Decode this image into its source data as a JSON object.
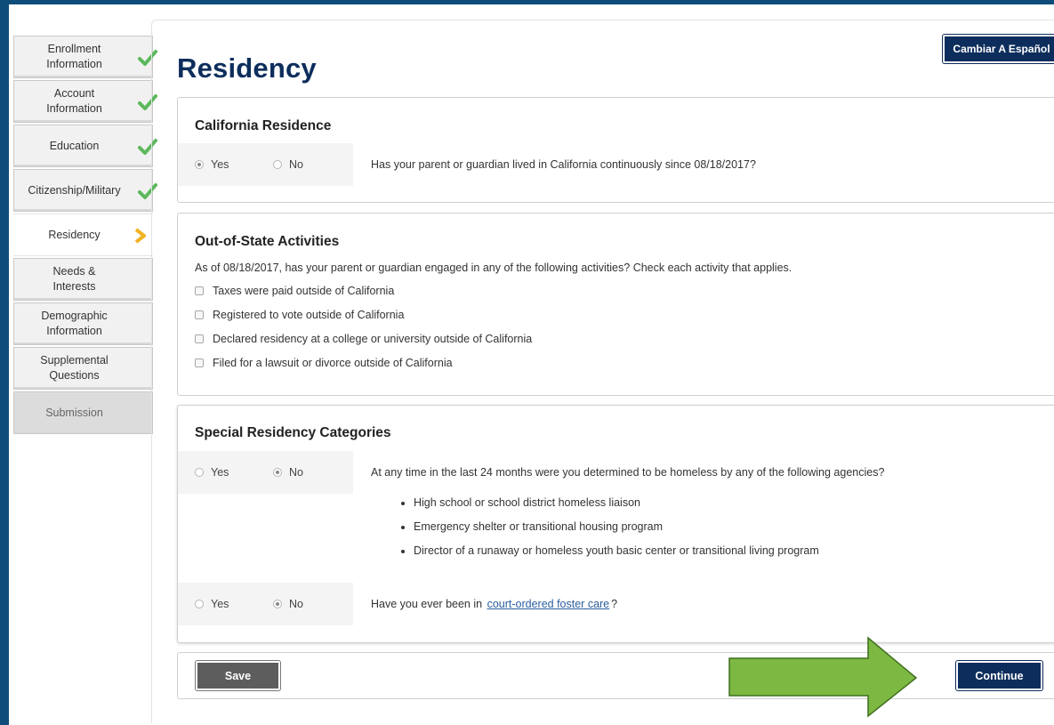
{
  "sidebar": {
    "items": [
      {
        "label_lines": [
          "Enrollment",
          "Information"
        ],
        "status": "complete"
      },
      {
        "label_lines": [
          "Account",
          "Information"
        ],
        "status": "complete"
      },
      {
        "label_lines": [
          "Education"
        ],
        "status": "complete"
      },
      {
        "label_lines": [
          "Citizenship/Military"
        ],
        "status": "complete"
      },
      {
        "label_lines": [
          "Residency"
        ],
        "status": "current"
      },
      {
        "label_lines": [
          "Needs &",
          "Interests"
        ],
        "status": "pending"
      },
      {
        "label_lines": [
          "Demographic",
          "Information"
        ],
        "status": "pending"
      },
      {
        "label_lines": [
          "Supplemental",
          "Questions"
        ],
        "status": "pending"
      },
      {
        "label_lines": [
          "Submission"
        ],
        "status": "disabled"
      }
    ]
  },
  "header": {
    "title": "Residency",
    "language_button": "Cambiar A Español"
  },
  "california_residence": {
    "heading": "California Residence",
    "yes_label": "Yes",
    "no_label": "No",
    "selected": "Yes",
    "question": "Has your parent or guardian lived in California continuously since 08/18/2017?"
  },
  "out_of_state": {
    "heading": "Out-of-State Activities",
    "intro": "As of 08/18/2017, has your parent or guardian engaged in any of the following activities? Check each activity that applies.",
    "options": [
      {
        "label": "Taxes were paid outside of California",
        "checked": false
      },
      {
        "label": "Registered to vote outside of California",
        "checked": false
      },
      {
        "label": "Declared residency at a college or university outside of California",
        "checked": false
      },
      {
        "label": "Filed for a lawsuit or divorce outside of California",
        "checked": false
      }
    ]
  },
  "special": {
    "heading": "Special Residency Categories",
    "homeless": {
      "yes_label": "Yes",
      "no_label": "No",
      "selected": "No",
      "question": "At any time in the last 24 months were you determined to be homeless by any of the following agencies?",
      "agencies": [
        "High school or school district homeless liaison",
        "Emergency shelter or transitional housing program",
        "Director of a runaway or homeless youth basic center or transitional living program"
      ]
    },
    "foster": {
      "yes_label": "Yes",
      "no_label": "No",
      "selected": "No",
      "question_before": "Have you ever been in",
      "link_text": "court-ordered foster care",
      "question_after": "?"
    }
  },
  "footer": {
    "save_label": "Save",
    "continue_label": "Continue"
  },
  "colors": {
    "navy": "#0d2e5c",
    "check_green": "#5cb85c",
    "current_arrow": "#f0b323",
    "callout_arrow": "#7db942"
  },
  "icons": {
    "complete": "checkmark-icon",
    "current": "chevron-right-icon",
    "callout": "callout-arrow-icon"
  }
}
